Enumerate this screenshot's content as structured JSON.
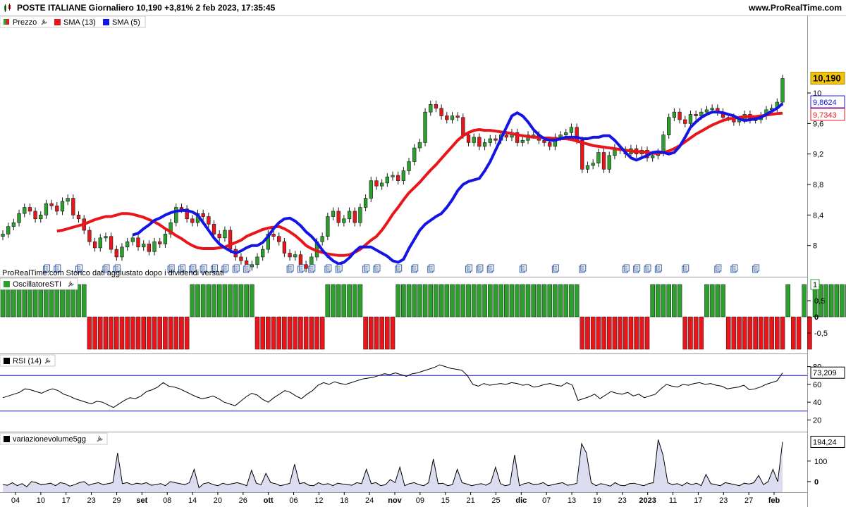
{
  "header": {
    "title": "POSTE ITALIANE Giornaliero 10,190 +3,81% 2 feb 2023, 17:35:45",
    "site": "www.ProRealTime.com"
  },
  "legend": {
    "price": "Prezzo",
    "sma13": "SMA (13)",
    "sma5": "SMA (5)",
    "osc": "OscillatoreSTI",
    "rsi": "RSI (14)",
    "vol": "variazionevolume5gg"
  },
  "note": "ProRealTime.com  Storico dati aggiustato dopo i dividendi versati",
  "colors": {
    "up": "#2ca02c",
    "down": "#e8161b",
    "sma13": "#e8161b",
    "sma5": "#1414e6",
    "price_tag": "#f2c40f"
  },
  "chart_data": [
    {
      "type": "candlestick",
      "name": "price",
      "ylim": [
        7.6,
        10.85
      ],
      "y_ticks": [
        "8",
        "8,4",
        "8,8",
        "9,2",
        "9,6",
        "10"
      ],
      "y_tick_values": [
        8.0,
        8.4,
        8.8,
        9.2,
        9.6,
        10.0
      ],
      "close": [
        8.15,
        8.25,
        8.3,
        8.42,
        8.5,
        8.45,
        8.35,
        8.4,
        8.55,
        8.52,
        8.45,
        8.58,
        8.62,
        8.4,
        8.35,
        8.2,
        8.05,
        7.97,
        8.1,
        8.12,
        7.95,
        7.85,
        7.98,
        8.05,
        8.1,
        7.98,
        8.02,
        7.92,
        8.05,
        8.02,
        8.15,
        8.3,
        8.5,
        8.48,
        8.35,
        8.3,
        8.42,
        8.38,
        8.28,
        8.15,
        8.1,
        8.2,
        7.95,
        7.85,
        7.8,
        7.72,
        7.75,
        7.85,
        7.95,
        8.15,
        8.12,
        8.05,
        7.9,
        7.85,
        7.88,
        7.75,
        7.7,
        7.85,
        8.05,
        8.12,
        8.38,
        8.45,
        8.3,
        8.35,
        8.45,
        8.3,
        8.5,
        8.62,
        8.85,
        8.78,
        8.82,
        8.9,
        8.92,
        8.85,
        8.98,
        9.1,
        9.28,
        9.35,
        9.75,
        9.85,
        9.8,
        9.7,
        9.65,
        9.7,
        9.68,
        9.45,
        9.35,
        9.42,
        9.3,
        9.35,
        9.4,
        9.38,
        9.45,
        9.42,
        9.48,
        9.35,
        9.38,
        9.45,
        9.45,
        9.38,
        9.35,
        9.3,
        9.42,
        9.45,
        9.48,
        9.55,
        9.38,
        9.0,
        9.05,
        9.08,
        9.22,
        9.0,
        9.18,
        9.28,
        9.25,
        9.2,
        9.27,
        9.2,
        9.25,
        9.15,
        9.18,
        9.22,
        9.45,
        9.68,
        9.75,
        9.65,
        9.6,
        9.72,
        9.7,
        9.75,
        9.78,
        9.8,
        9.75,
        9.68,
        9.68,
        9.62,
        9.65,
        9.72,
        9.65,
        9.65,
        9.7,
        9.78,
        9.8,
        9.88,
        10.19
      ],
      "sma13": [
        8.19,
        8.2,
        8.22,
        8.24,
        8.26,
        8.28,
        8.31,
        8.34,
        8.36,
        8.38,
        8.38,
        8.4,
        8.42,
        8.42,
        8.41,
        8.39,
        8.37,
        8.34,
        8.31,
        8.27,
        8.22,
        8.18,
        8.13,
        8.09,
        8.04,
        8.0,
        7.97,
        7.96,
        7.96,
        7.96,
        7.97,
        7.98,
        8.01,
        8.04,
        8.07,
        8.12,
        8.15,
        8.18,
        8.21,
        8.23,
        8.24,
        8.25,
        8.22,
        8.18,
        8.13,
        8.07,
        8.0,
        7.96,
        7.93,
        7.91,
        7.89,
        7.88,
        7.87,
        7.87,
        7.88,
        7.91,
        7.95,
        8.01,
        8.07,
        8.12,
        8.2,
        8.3,
        8.41,
        8.5,
        8.6,
        8.69,
        8.76,
        8.83,
        8.91,
        8.99,
        9.06,
        9.14,
        9.22,
        9.3,
        9.38,
        9.44,
        9.48,
        9.51,
        9.52,
        9.51,
        9.51,
        9.5,
        9.49,
        9.48,
        9.47,
        9.45,
        9.44,
        9.43,
        9.42,
        9.42,
        9.41,
        9.41,
        9.4,
        9.4,
        9.4,
        9.39,
        9.37,
        9.35,
        9.33,
        9.31,
        9.3,
        9.29,
        9.28,
        9.27,
        9.26,
        9.25,
        9.24,
        9.23,
        9.23,
        9.22,
        9.21,
        9.21,
        9.22,
        9.24,
        9.27,
        9.31,
        9.36,
        9.41,
        9.46,
        9.5,
        9.54,
        9.58,
        9.61,
        9.64,
        9.66,
        9.67,
        9.68,
        9.69,
        9.69,
        9.69,
        9.7,
        9.71,
        9.72,
        9.73,
        9.7343
      ],
      "sma5": [
        8.14,
        8.16,
        8.22,
        8.27,
        8.33,
        8.36,
        8.4,
        8.43,
        8.45,
        8.46,
        8.46,
        8.44,
        8.4,
        8.3,
        8.2,
        8.1,
        8.02,
        7.97,
        7.93,
        7.9,
        7.93,
        7.97,
        8.0,
        8.0,
        8.04,
        8.12,
        8.22,
        8.3,
        8.35,
        8.36,
        8.32,
        8.26,
        8.18,
        8.12,
        8.04,
        7.94,
        7.86,
        7.8,
        7.76,
        7.78,
        7.84,
        7.92,
        7.98,
        7.98,
        7.98,
        7.94,
        7.9,
        7.86,
        7.8,
        7.78,
        7.82,
        7.96,
        8.08,
        8.2,
        8.28,
        8.33,
        8.38,
        8.42,
        8.5,
        8.6,
        8.72,
        8.8,
        8.84,
        8.86,
        8.88,
        8.98,
        9.1,
        9.25,
        9.4,
        9.55,
        9.7,
        9.74,
        9.7,
        9.62,
        9.52,
        9.45,
        9.4,
        9.38,
        9.38,
        9.4,
        9.42,
        9.42,
        9.42,
        9.4,
        9.4,
        9.42,
        9.42,
        9.44,
        9.44,
        9.38,
        9.3,
        9.22,
        9.15,
        9.12,
        9.15,
        9.18,
        9.22,
        9.23,
        9.22,
        9.2,
        9.22,
        9.3,
        9.42,
        9.55,
        9.62,
        9.68,
        9.72,
        9.75,
        9.75,
        9.74,
        9.72,
        9.7,
        9.66,
        9.64,
        9.65,
        9.66,
        9.68,
        9.72,
        9.76,
        9.8,
        9.8624
      ],
      "last_close": "10,190",
      "last_sma5": "9,8624",
      "last_sma13": "9,7343"
    },
    {
      "type": "bar",
      "name": "OscillatoreSTI",
      "ylim": [
        -1,
        1
      ],
      "y_ticks": [
        "0,5",
        "0",
        "-0,5"
      ],
      "y_tick_values": [
        0.5,
        0,
        -0.5
      ],
      "last": "1",
      "runs": [
        [
          16,
          1
        ],
        [
          19,
          -1
        ],
        [
          12,
          1
        ],
        [
          13,
          -1
        ],
        [
          7,
          1
        ],
        [
          6,
          -1
        ],
        [
          34,
          1
        ],
        [
          13,
          -1
        ],
        [
          6,
          1
        ],
        [
          4,
          -1
        ],
        [
          4,
          1
        ],
        [
          11,
          -1
        ],
        [
          1,
          1
        ],
        [
          2,
          -1
        ],
        [
          1,
          1
        ],
        [
          1,
          -1
        ],
        [
          20,
          1
        ],
        [
          7,
          -1
        ],
        [
          7,
          1
        ]
      ]
    },
    {
      "type": "line",
      "name": "RSI (14)",
      "ylim": [
        10,
        90
      ],
      "y_ticks": [
        "80",
        "60",
        "40",
        "20"
      ],
      "y_tick_values": [
        80,
        60,
        40,
        20
      ],
      "hlines": [
        70,
        30
      ],
      "last": "73,209",
      "values": [
        45,
        47,
        49,
        51,
        55,
        54,
        52,
        50,
        53,
        55,
        53,
        49,
        47,
        44,
        42,
        40,
        38,
        41,
        40,
        37,
        34,
        38,
        42,
        45,
        44,
        47,
        52,
        54,
        57,
        62,
        58,
        57,
        55,
        52,
        49,
        46,
        44,
        45,
        47,
        44,
        40,
        38,
        36,
        41,
        46,
        50,
        48,
        43,
        40,
        45,
        49,
        53,
        51,
        47,
        44,
        49,
        53,
        59,
        62,
        60,
        63,
        61,
        60,
        62,
        64,
        66,
        67,
        68,
        70,
        72,
        71,
        73,
        71,
        69,
        72,
        73,
        75,
        77,
        79,
        82,
        80,
        78,
        77,
        76,
        70,
        60,
        58,
        61,
        59,
        60,
        61,
        60,
        62,
        61,
        59,
        60,
        57,
        58,
        60,
        61,
        59,
        58,
        62,
        59,
        42,
        44,
        46,
        49,
        44,
        48,
        52,
        50,
        49,
        51,
        47,
        49,
        45,
        47,
        49,
        55,
        60,
        58,
        57,
        60,
        59,
        61,
        62,
        60,
        61,
        59,
        58,
        55,
        56,
        57,
        59,
        54,
        55,
        57,
        60,
        62,
        64,
        73
      ]
    },
    {
      "type": "area",
      "name": "variazionevolume5gg",
      "ylim": [
        -45,
        230
      ],
      "y_ticks": [
        "100",
        "0"
      ],
      "y_tick_values": [
        100,
        0
      ],
      "last": "194,24",
      "values": [
        -15,
        -18,
        -5,
        -20,
        -10,
        -25,
        0,
        -5,
        -15,
        -12,
        -8,
        -20,
        -5,
        -10,
        -22,
        -15,
        -5,
        0,
        -18,
        -10,
        -5,
        -15,
        -10,
        -5,
        140,
        -10,
        -5,
        -15,
        -8,
        -12,
        -5,
        -18,
        -15,
        -10,
        -20,
        0,
        -5,
        -10,
        -15,
        -5,
        60,
        -30,
        -10,
        -5,
        -15,
        -20,
        -8,
        -15,
        -10,
        -5,
        -12,
        -20,
        55,
        -8,
        -15,
        40,
        -5,
        -10,
        -20,
        -15,
        -8,
        85,
        -10,
        -5,
        -18,
        -20,
        -5,
        -15,
        -10,
        -20,
        -8,
        -12,
        -15,
        -18,
        -5,
        -10,
        60,
        -10,
        -5,
        -20,
        -15,
        10,
        -5,
        70,
        -20,
        -10,
        -5,
        -15,
        -20,
        -5,
        110,
        -10,
        -8,
        -20,
        -15,
        60,
        -5,
        -12,
        -20,
        -15,
        -10,
        -18,
        -5,
        70,
        -10,
        -20,
        -15,
        130,
        -20,
        -10,
        -5,
        -15,
        -12,
        -5,
        -20,
        -15,
        -10,
        -5,
        -18,
        -15,
        -8,
        185,
        140,
        -5,
        -20,
        -10,
        -15,
        -22,
        -5,
        -18,
        -20,
        -10,
        -8,
        -15,
        -20,
        -10,
        -5,
        205,
        130,
        -5,
        -15,
        -10,
        -20,
        -5,
        -15,
        -8,
        -20,
        35,
        -10,
        -15,
        -20,
        -5,
        -10,
        -15,
        -20,
        -8,
        -12,
        -5,
        30,
        -15,
        0,
        60,
        0,
        194
      ]
    },
    {
      "type": "axis",
      "name": "dates",
      "x_labels": [
        "04",
        "10",
        "17",
        "23",
        "29",
        "set",
        "08",
        "14",
        "20",
        "26",
        "ott",
        "06",
        "12",
        "18",
        "24",
        "nov",
        "09",
        "15",
        "21",
        "25",
        "dic",
        "07",
        "13",
        "19",
        "23",
        "2023",
        "11",
        "17",
        "23",
        "27",
        "feb"
      ],
      "bold": [
        "set",
        "ott",
        "nov",
        "dic",
        "2023",
        "feb"
      ]
    }
  ]
}
